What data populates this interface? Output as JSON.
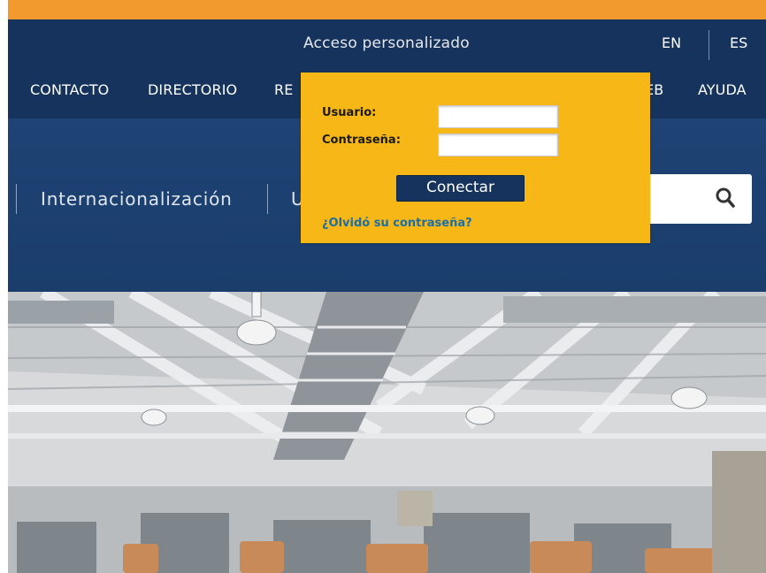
{
  "header": {
    "acceso_label": "Acceso personalizado",
    "lang_en": "EN",
    "lang_es": "ES"
  },
  "nav": {
    "items": [
      "CONTACTO",
      "DIRECTORIO",
      "RE",
      "EB",
      "AYUDA"
    ]
  },
  "band": {
    "links": [
      "Internacionalización",
      "U"
    ]
  },
  "login": {
    "usuario_label": "Usuario:",
    "usuario_value": "",
    "password_label": "Contraseña:",
    "password_value": "",
    "connect_button": "Conectar",
    "forgot_link": "¿Olvidó su contraseña?"
  },
  "icons": {
    "search": "search-icon"
  },
  "colors": {
    "orange_strip": "#f29a2e",
    "navy": "#15335c",
    "band_blue": "#1e4374",
    "login_yellow": "#f7b716",
    "link_blue": "#1d6ea3"
  }
}
